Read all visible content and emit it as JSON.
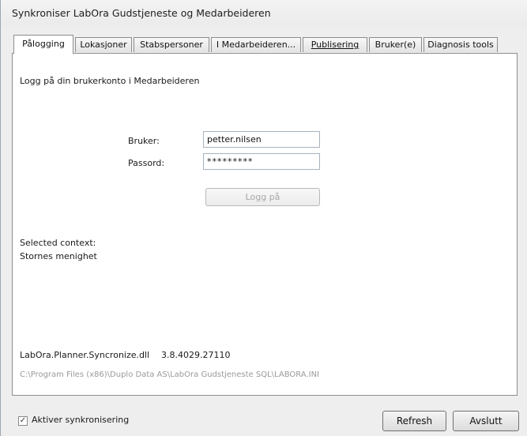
{
  "window": {
    "title": "Synkroniser LabOra Gudstjeneste og Medarbeideren"
  },
  "tabs": [
    {
      "label": "Pålogging",
      "active": true
    },
    {
      "label": "Lokasjoner"
    },
    {
      "label": "Stabspersoner"
    },
    {
      "label": "I Medarbeideren..."
    },
    {
      "label": "Publisering"
    },
    {
      "label": "Bruker(e)"
    },
    {
      "label": "Diagnosis tools"
    }
  ],
  "login": {
    "heading": "Logg på din brukerkonto i Medarbeideren",
    "user_label": "Bruker:",
    "user_value": "petter.nilsen",
    "password_label": "Passord:",
    "password_value": "*********",
    "login_button": "Logg på"
  },
  "context": {
    "label": "Selected context:",
    "value": "Stornes menighet"
  },
  "info": {
    "dll_name": "LabOra.Planner.Syncronize.dll",
    "dll_version": "3.8.4029.27110",
    "ini_path": "C:\\Program Files (x86)\\Duplo Data AS\\LabOra Gudstjeneste SQL\\LABORA.INI"
  },
  "footer": {
    "sync_checkbox_label": "Aktiver synkronisering",
    "sync_checked": true,
    "refresh_button": "Refresh",
    "close_button": "Avslutt"
  }
}
